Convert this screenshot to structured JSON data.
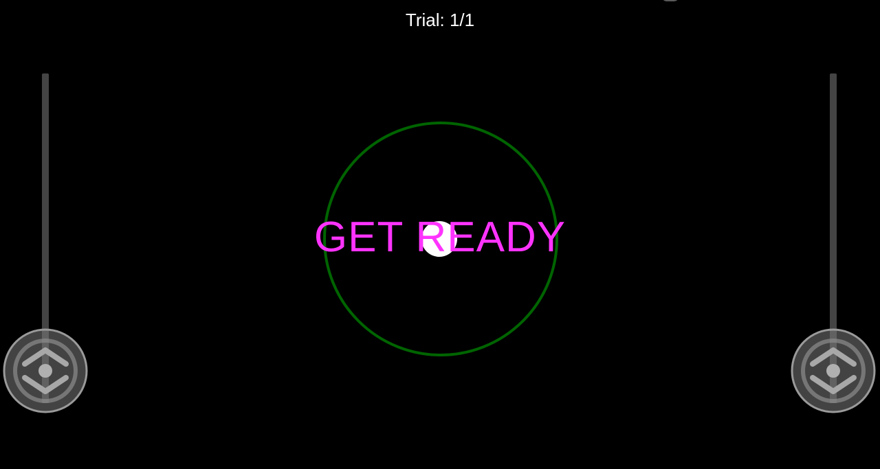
{
  "hud": {
    "trial_text": "Trial: 1/1"
  },
  "center": {
    "message": "GET READY",
    "message_color": "#ff33ff",
    "ring_color": "#006400",
    "cursor_color": "#ffffff"
  },
  "controls": {
    "left_joystick_icon": "vertical-joystick-icon",
    "right_joystick_icon": "vertical-joystick-icon",
    "track_color": "#444444",
    "knob_color": "#7a7a7a"
  },
  "colors": {
    "background": "#000000",
    "text": "#ffffff"
  }
}
